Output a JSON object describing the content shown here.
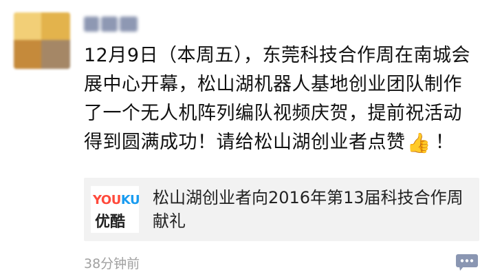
{
  "post": {
    "text_part1": "12月9日（本周五），东莞科技合作周在南城会展中心开幕，松山湖机器人基地创业团队制作了一个无人机阵列编队视频庆贺，提前祝活动得到圆满成功！请给松山湖创业者点赞",
    "thumbs_emoji": "👍",
    "text_part2": "！",
    "time": "38分钟前"
  },
  "link": {
    "logo_you": "YOU",
    "logo_ku": "KU",
    "logo_cn": "优酷",
    "title": "松山湖创业者向2016年第13届科技合作周献礼"
  },
  "colors": {
    "youku_red": "#ff4a3c",
    "youku_blue": "#1a9cf0",
    "comment_icon": "#8a96b2"
  },
  "icons": {
    "comment": "comment-bubble-icon"
  }
}
